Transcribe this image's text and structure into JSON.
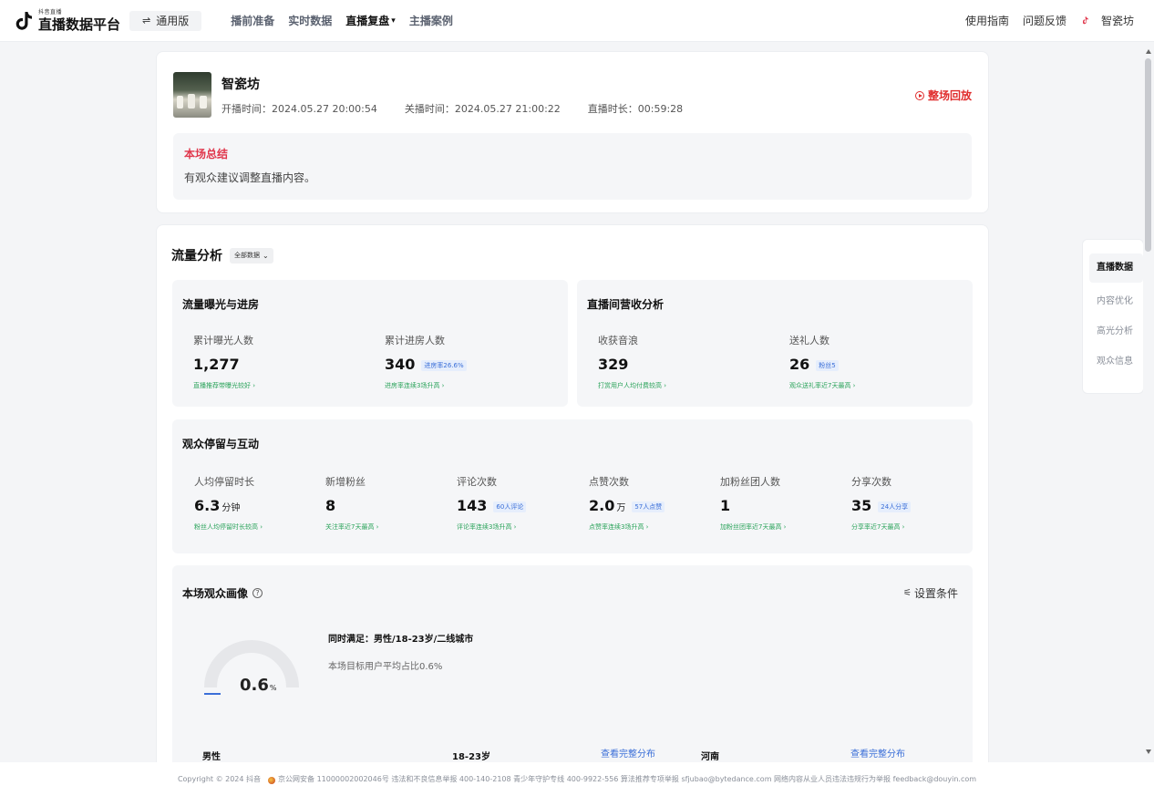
{
  "header": {
    "logo_small": "抖音直播",
    "logo_title": "直播数据平台",
    "version_icon": "swap-icon",
    "version_label": "通用版",
    "nav": [
      {
        "label": "播前准备"
      },
      {
        "label": "实时数据"
      },
      {
        "label": "直播复盘",
        "active": true
      },
      {
        "label": "主播案例"
      }
    ],
    "links": [
      "使用指南",
      "问题反馈"
    ],
    "user_name": "智瓷坊"
  },
  "room": {
    "name": "智瓷坊",
    "start_time": "开播时间：2024.05.27 20:00:54",
    "end_time": "关播时间：2024.05.27 21:00:22",
    "duration": "直播时长：00:59:28",
    "replay_label": "整场回放",
    "summary_title": "本场总结",
    "summary_text": "有观众建议调整直播内容。"
  },
  "flow": {
    "title": "流量分析",
    "filter_label": "全部数据",
    "exposure": {
      "title": "流量曝光与进房",
      "metrics": [
        {
          "label": "累计曝光人数",
          "value": "1,277",
          "badge": "",
          "hint": "直播推荐带曝光较好 ›"
        },
        {
          "label": "累计进房人数",
          "value": "340",
          "badge": "进房率26.6%",
          "hint": "进房率连续3场升高 ›"
        }
      ]
    },
    "revenue": {
      "title": "直播间营收分析",
      "metrics": [
        {
          "label": "收获音浪",
          "value": "329",
          "badge": "",
          "hint": "打赏用户人均付费较高 ›"
        },
        {
          "label": "送礼人数",
          "value": "26",
          "badge": "粉丝5",
          "hint": "观众送礼率近7天最高 ›"
        }
      ]
    },
    "engagement": {
      "title": "观众停留与互动",
      "metrics": [
        {
          "label": "人均停留时长",
          "value": "6.3",
          "unit": "分钟",
          "badge": "",
          "hint": "粉丝人均停留时长较高 ›"
        },
        {
          "label": "新增粉丝",
          "value": "8",
          "unit": "",
          "badge": "",
          "hint": "关注率近7天最高 ›"
        },
        {
          "label": "评论次数",
          "value": "143",
          "unit": "",
          "badge": "60人评论",
          "hint": "评论率连续3场升高 ›"
        },
        {
          "label": "点赞次数",
          "value": "2.0",
          "unit": "万",
          "badge": "57人点赞",
          "hint": "点赞率连续3场升高 ›"
        },
        {
          "label": "加粉丝团人数",
          "value": "1",
          "unit": "",
          "badge": "",
          "hint": "加粉丝团率近7天最高 ›"
        },
        {
          "label": "分享次数",
          "value": "35",
          "unit": "",
          "badge": "24人分享",
          "hint": "分享率近7天最高 ›"
        }
      ]
    }
  },
  "portrait": {
    "title": "本场观众画像",
    "help_icon": "question-circle-icon",
    "settings_label": "设置条件",
    "gauge_value": "0.6",
    "gauge_unit": "%",
    "gauge_fraction": 0.006,
    "condition_title": "同时满足：男性/18-23岁/二线城市",
    "condition_text": "本场目标用户平均占比0.6%",
    "dist": [
      {
        "label": "男性",
        "link": ""
      },
      {
        "label": "18-23岁",
        "link": "查看完整分布"
      },
      {
        "label": "河南",
        "link": "查看完整分布"
      }
    ]
  },
  "side_nav": {
    "items": [
      {
        "label": "直播数据",
        "active": true
      },
      {
        "label": "内容优化"
      },
      {
        "label": "高光分析"
      },
      {
        "label": "观众信息"
      }
    ]
  },
  "footer": {
    "copyright": "Copyright © 2024 抖音",
    "icp": "京公网安备 11000002002046号",
    "report_line": "违法和不良信息举报 400-140-2108",
    "youth_line": "青少年守护专线 400-9922-556",
    "algo_line": "算法推荐专项举报 sfjubao@bytedance.com",
    "net_line": "网络内容从业人员违法违规行为举报 feedback@douyin.com",
    "colors": {
      "accent_red": "#e0364b",
      "link_blue": "#3b6fd8",
      "hint_green": "#2aa35a"
    }
  }
}
